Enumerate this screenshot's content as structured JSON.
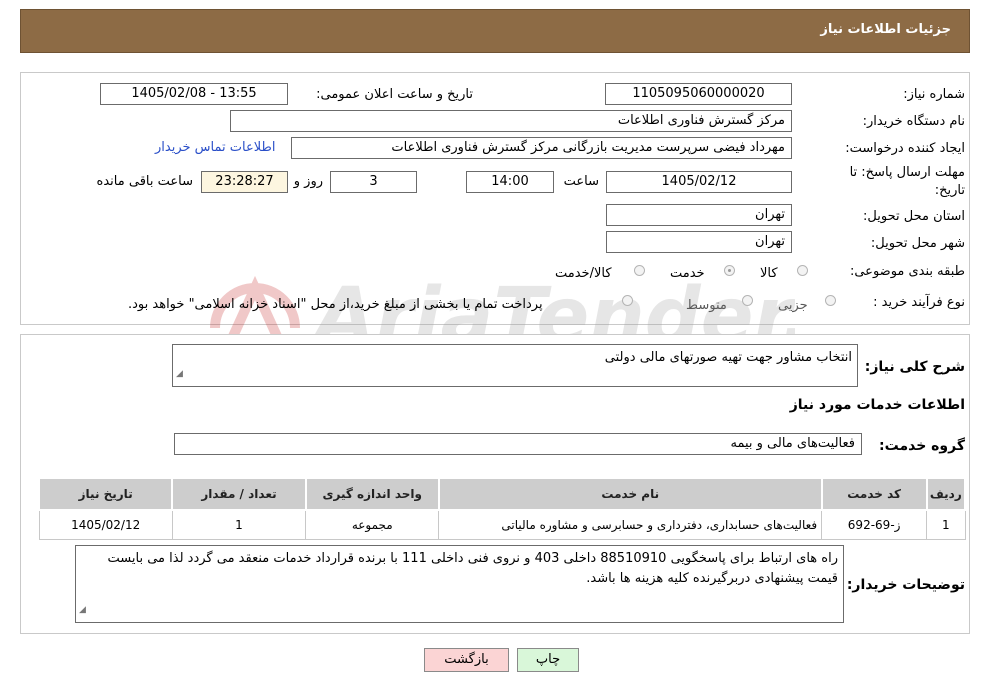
{
  "header": {
    "title": "جزئیات اطلاعات نیاز"
  },
  "form": {
    "need_number_label": "شماره نیاز:",
    "need_number": "1105095060000020",
    "announce_label": "تاریخ و ساعت اعلان عمومی:",
    "announce_value": "1405/02/08 - 13:55",
    "buyer_org_label": "نام دستگاه خریدار:",
    "buyer_org": "مرکز گسترش فناوری اطلاعات",
    "creator_label": "ایجاد کننده درخواست:",
    "creator": "مهرداد فیضی سرپرست مدیریت بازرگانی مرکز گسترش فناوری اطلاعات",
    "contact_link": "اطلاعات تماس خریدار",
    "deadline_label_1": "مهلت ارسال پاسخ: تا",
    "deadline_label_2": "تاریخ:",
    "deadline_date": "1405/02/12",
    "time_label": "ساعت",
    "deadline_time": "14:00",
    "days_value": "3",
    "days_label": "روز و",
    "remaining_time": "23:28:27",
    "remaining_label": "ساعت باقی مانده",
    "province_label": "استان محل تحویل:",
    "province": "تهران",
    "city_label": "شهر محل تحویل:",
    "city": "تهران",
    "category_label": "طبقه بندی موضوعی:",
    "category_options": [
      "کالا",
      "خدمت",
      "کالا/خدمت"
    ],
    "category_selected": "خدمت",
    "process_label": "نوع فرآیند خرید :",
    "process_options": [
      "جزیی",
      "متوسط"
    ],
    "payment_note": "پرداخت تمام یا بخشی از مبلغ خرید،از محل \"اسناد خزانه اسلامی\" خواهد بود."
  },
  "details": {
    "description_label": "شرح کلی نیاز:",
    "description": "انتخاب مشاور جهت تهیه صورتهای مالی دولتی",
    "services_heading": "اطلاعات خدمات مورد نیاز",
    "service_group_label": "گروه خدمت:",
    "service_group": "فعالیت‌های مالی و بیمه",
    "table": {
      "headers": [
        "ردیف",
        "کد خدمت",
        "نام خدمت",
        "واحد اندازه گیری",
        "تعداد / مقدار",
        "تاریخ نیاز"
      ],
      "rows": [
        [
          "1",
          "ز-69-692",
          "فعالیت‌های حسابداری، دفترداری و حسابرسی و مشاوره مالیاتی",
          "مجموعه",
          "1",
          "1405/02/12"
        ]
      ]
    },
    "buyer_notes_label": "توضیحات خریدار:",
    "buyer_notes": "راه های ارتباط برای پاسخگویی 88510910 داخلی 403 و نروی فنی داخلی 111 با برنده قرارداد خدمات منعقد می گردد لذا می بایست قیمت پیشنهادی دربرگیرنده کلیه هزینه ها باشد."
  },
  "buttons": {
    "print": "چاپ",
    "back": "بازگشت"
  },
  "watermark": {
    "text": "AriaTender.net"
  },
  "colors": {
    "header_bg": "#8d6b45",
    "print_btn": "#d9f7d9",
    "back_btn": "#fbd4d4",
    "link": "#2a4fc8"
  }
}
